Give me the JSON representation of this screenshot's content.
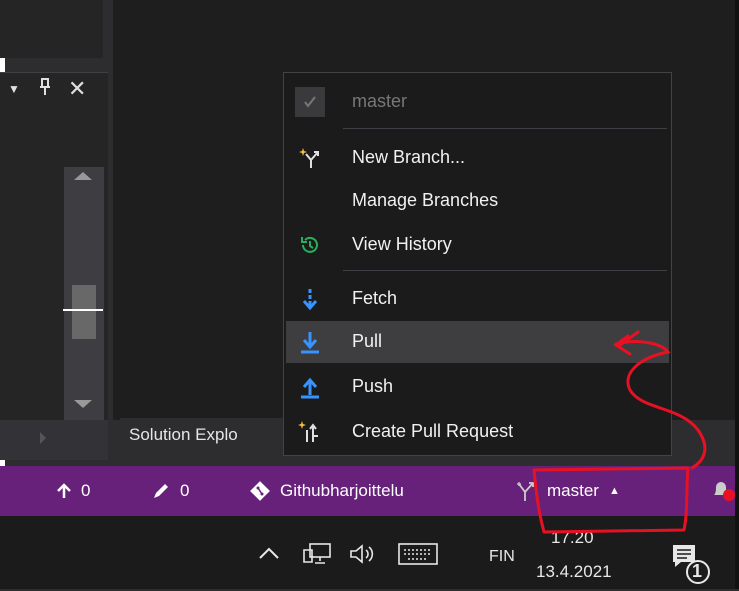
{
  "background_panel": {
    "solution_tab_label": "Solution Explo"
  },
  "branch_menu": {
    "current_branch": "master",
    "items": [
      {
        "label": "New Branch...",
        "icon": "new-branch-icon"
      },
      {
        "label": "Manage Branches",
        "icon": ""
      },
      {
        "label": "View History",
        "icon": "history-icon"
      },
      {
        "label": "Fetch",
        "icon": "fetch-icon"
      },
      {
        "label": "Pull",
        "icon": "pull-icon"
      },
      {
        "label": "Push",
        "icon": "push-icon"
      },
      {
        "label": "Create Pull Request",
        "icon": "pull-request-icon"
      }
    ]
  },
  "status_bar": {
    "unpushed_commits": "0",
    "pending_changes": "0",
    "repository": "Githubharjoittelu",
    "branch": "master",
    "color": "#68217a"
  },
  "taskbar": {
    "language": "FIN",
    "time": "17.20",
    "date": "13.4.2021",
    "notification_count": "1"
  },
  "colors": {
    "accent_blue": "#3794ff",
    "history_green": "#27b05b",
    "annotation_red": "#e81123"
  }
}
